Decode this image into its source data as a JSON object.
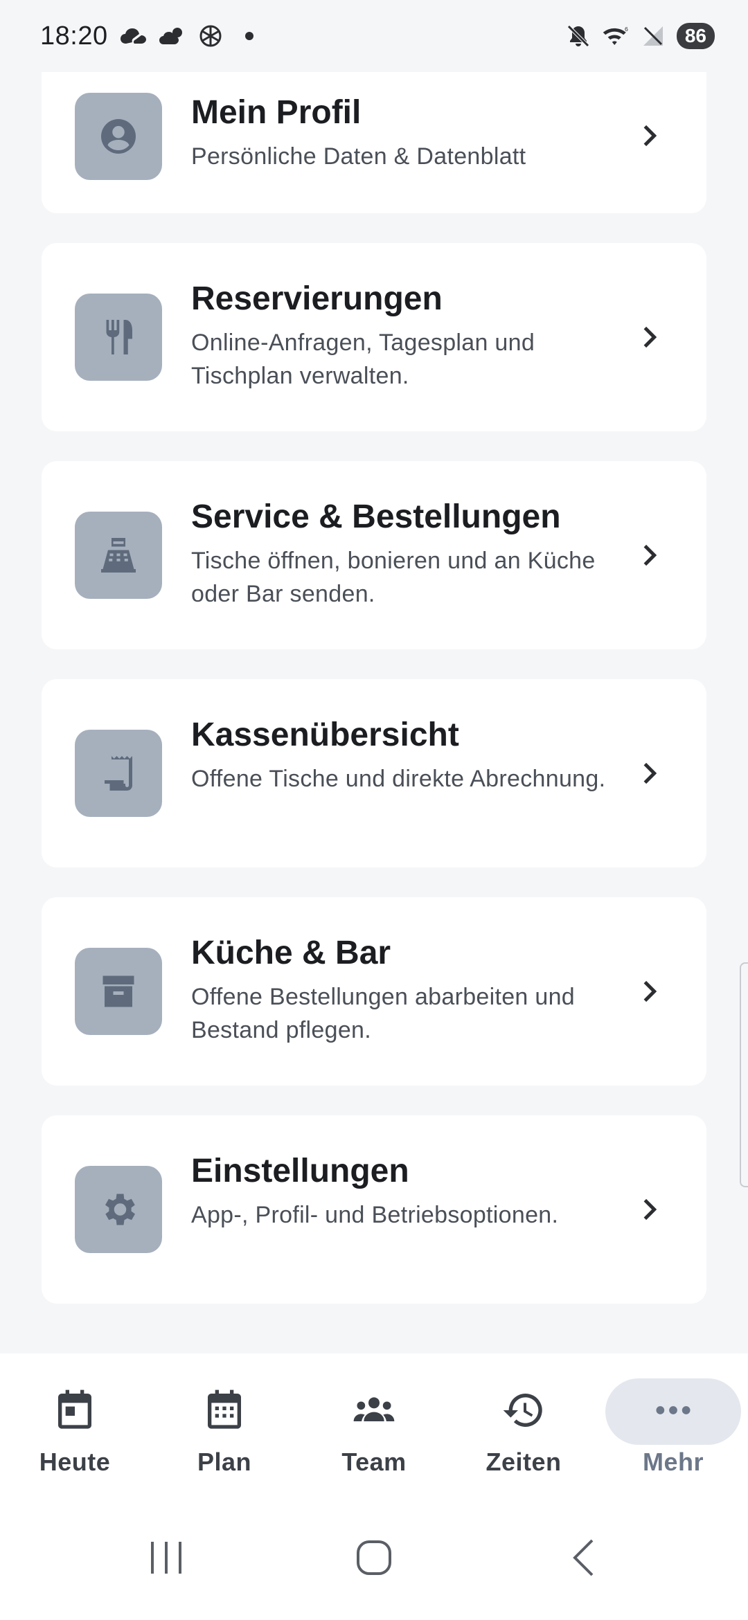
{
  "status": {
    "time": "18:20",
    "battery": "86",
    "left_icons": [
      "cloud-icon",
      "weather-icon",
      "openai-icon",
      "dot-icon"
    ],
    "right_icons": [
      "mute-icon",
      "wifi-icon",
      "no-signal-icon"
    ]
  },
  "cards": [
    {
      "title": "Mein Profil",
      "subtitle": "Persönliche Daten & Datenblatt",
      "icon": "person-icon"
    },
    {
      "title": "Reservierungen",
      "subtitle": "Online-Anfragen, Tagesplan und Tischplan verwalten.",
      "icon": "restaurant-icon"
    },
    {
      "title": "Service & Bestellungen",
      "subtitle": "Tische öffnen, bonieren und an Küche oder Bar senden.",
      "icon": "register-icon"
    },
    {
      "title": "Kassenübersicht",
      "subtitle": "Offene Tische und direkte Abrechnung.",
      "icon": "receipt-icon"
    },
    {
      "title": "Küche & Bar",
      "subtitle": "Offene Bestellungen abarbeiten und Bestand pflegen.",
      "icon": "archive-icon"
    },
    {
      "title": "Einstellungen",
      "subtitle": "App-, Profil- und Betriebsoptionen.",
      "icon": "gear-icon"
    }
  ],
  "bottom_nav": [
    {
      "label": "Heute",
      "icon": "calendar-today-icon",
      "active": false
    },
    {
      "label": "Plan",
      "icon": "calendar-month-icon",
      "active": false
    },
    {
      "label": "Team",
      "icon": "group-icon",
      "active": false
    },
    {
      "label": "Zeiten",
      "icon": "history-icon",
      "active": false
    },
    {
      "label": "Mehr",
      "icon": "more-horizontal-icon",
      "active": true
    }
  ],
  "colors": {
    "background": "#f5f6f8",
    "card": "#ffffff",
    "icon_tile": "#a6b0bd",
    "icon_glyph": "#5f6b7c",
    "active_label": "#6c7789",
    "active_pill": "#e4e8ee"
  }
}
